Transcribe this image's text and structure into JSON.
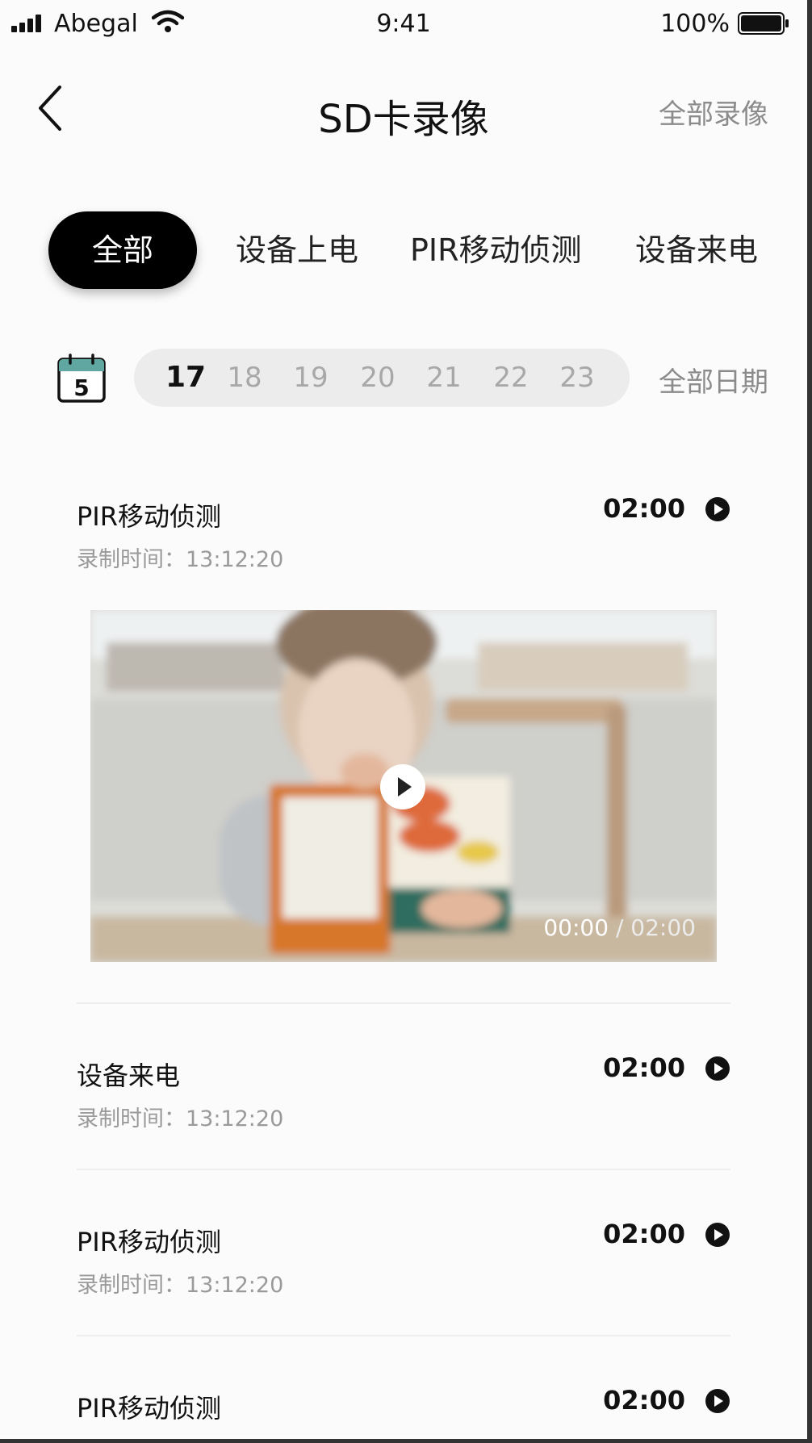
{
  "status_bar": {
    "carrier": "Abegal",
    "time": "9:41",
    "battery": "100%"
  },
  "nav": {
    "title": "SD卡录像",
    "right_action": "全部录像"
  },
  "filter_tabs": [
    {
      "label": "全部",
      "active": true
    },
    {
      "label": "设备上电",
      "active": false
    },
    {
      "label": "PIR移动侦测",
      "active": false
    },
    {
      "label": "设备来电",
      "active": false
    }
  ],
  "date_bar": {
    "calendar_day": "5",
    "days": [
      "17",
      "18",
      "19",
      "20",
      "21",
      "22",
      "23"
    ],
    "selected_day": "17",
    "all_dates": "全部日期"
  },
  "records": [
    {
      "title": "PIR移动侦测",
      "subtitle": "录制时间：13:12:20",
      "duration": "02:00",
      "expanded": true
    },
    {
      "title": "设备来电",
      "subtitle": "录制时间：13:12:20",
      "duration": "02:00",
      "expanded": false
    },
    {
      "title": "PIR移动侦测",
      "subtitle": "录制时间：13:12:20",
      "duration": "02:00",
      "expanded": false
    },
    {
      "title": "PIR移动侦测",
      "subtitle": "",
      "duration": "02:00",
      "expanded": false
    }
  ],
  "player": {
    "current": "00:00",
    "separator": " / ",
    "total": "02:00"
  },
  "icons": {
    "back": "chevron-left-icon",
    "calendar": "calendar-icon",
    "play": "play-circle-icon"
  },
  "colors": {
    "accent": "#000000",
    "muted": "#8b8b8b",
    "calendar_header": "#5fa7a0"
  }
}
